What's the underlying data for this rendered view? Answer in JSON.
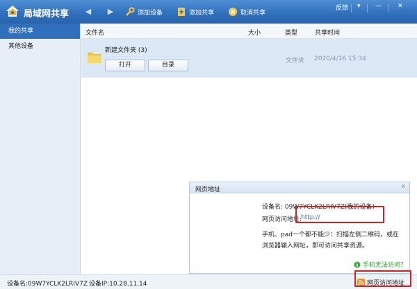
{
  "app": {
    "title": "局域网共享",
    "logo_icon": "house-share-icon"
  },
  "toolbar": {
    "back_icon": "back-arrow-icon",
    "forward_icon": "forward-arrow-icon",
    "add_device": "添加设备",
    "add_share": "添加共享",
    "cancel_share": "取消共享"
  },
  "window": {
    "feedback": "反馈",
    "minimize": "—",
    "close": "✕",
    "menu": "▾"
  },
  "sidebar": {
    "items": [
      {
        "label": "我的共享",
        "active": true
      },
      {
        "label": "其他设备",
        "active": false
      }
    ]
  },
  "columns": {
    "name": "文件名",
    "size": "大小",
    "type": "类型",
    "time": "共享时间"
  },
  "files": [
    {
      "name": "新建文件夹 (3)",
      "open": "打开",
      "dir": "目录",
      "type": "文件夹",
      "time": "2020/4/16 15:34"
    }
  ],
  "popup": {
    "title": "网页地址",
    "close": "x",
    "device": "设备名: 09W7YCLK2LRIV7Z(我的设备)",
    "url_label": "网页访问地址:",
    "url": "http://",
    "tip1": "手机、pad一个都不能少：扫描左侧二维码，或在",
    "tip2": "浏览器输入网址，即可访问共享资源。",
    "help": "手机无法访问？"
  },
  "status": {
    "device": "设备名:09W7YCLK2LRIV7Z",
    "ip": "设备IP:10.28.11.14",
    "web_address": "网页访问地址"
  },
  "colors": {
    "accent": "#2f6fbb",
    "highlight": "#d61f1f",
    "selected_row": "#dbe8f6"
  }
}
